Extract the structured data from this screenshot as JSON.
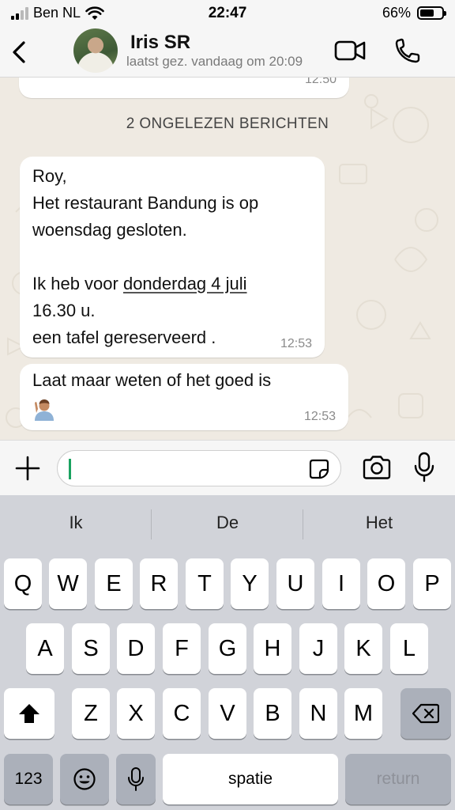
{
  "status_bar": {
    "carrier": "Ben NL",
    "time": "22:47",
    "battery": "66%",
    "battery_level": 0.66
  },
  "header": {
    "contact_name": "Iris SR",
    "status": "laatst gez. vandaag om 20:09"
  },
  "chat": {
    "previous_message_time": "12:50",
    "unread_banner": "2 ONGELEZEN BERICHTEN",
    "messages": [
      {
        "text_before": "Roy,\nHet restaurant  Bandung is op woensdag gesloten.\n\nIk heb voor ",
        "link": "donderdag 4 juli",
        "text_after": "\n16.30  u.\neen tafel gereserveerd .",
        "time": "12:53"
      },
      {
        "text": "Laat maar weten of het goed is",
        "emoji": "person-raising-hand",
        "time": "12:53"
      }
    ]
  },
  "input": {
    "placeholder": ""
  },
  "keyboard": {
    "suggestions": [
      "Ik",
      "De",
      "Het"
    ],
    "row1": [
      "Q",
      "W",
      "E",
      "R",
      "T",
      "Y",
      "U",
      "I",
      "O",
      "P"
    ],
    "row2": [
      "A",
      "S",
      "D",
      "F",
      "G",
      "H",
      "J",
      "K",
      "L"
    ],
    "row3": [
      "Z",
      "X",
      "C",
      "V",
      "B",
      "N",
      "M"
    ],
    "numbers_key": "123",
    "space_key": "spatie",
    "return_key": "return"
  }
}
